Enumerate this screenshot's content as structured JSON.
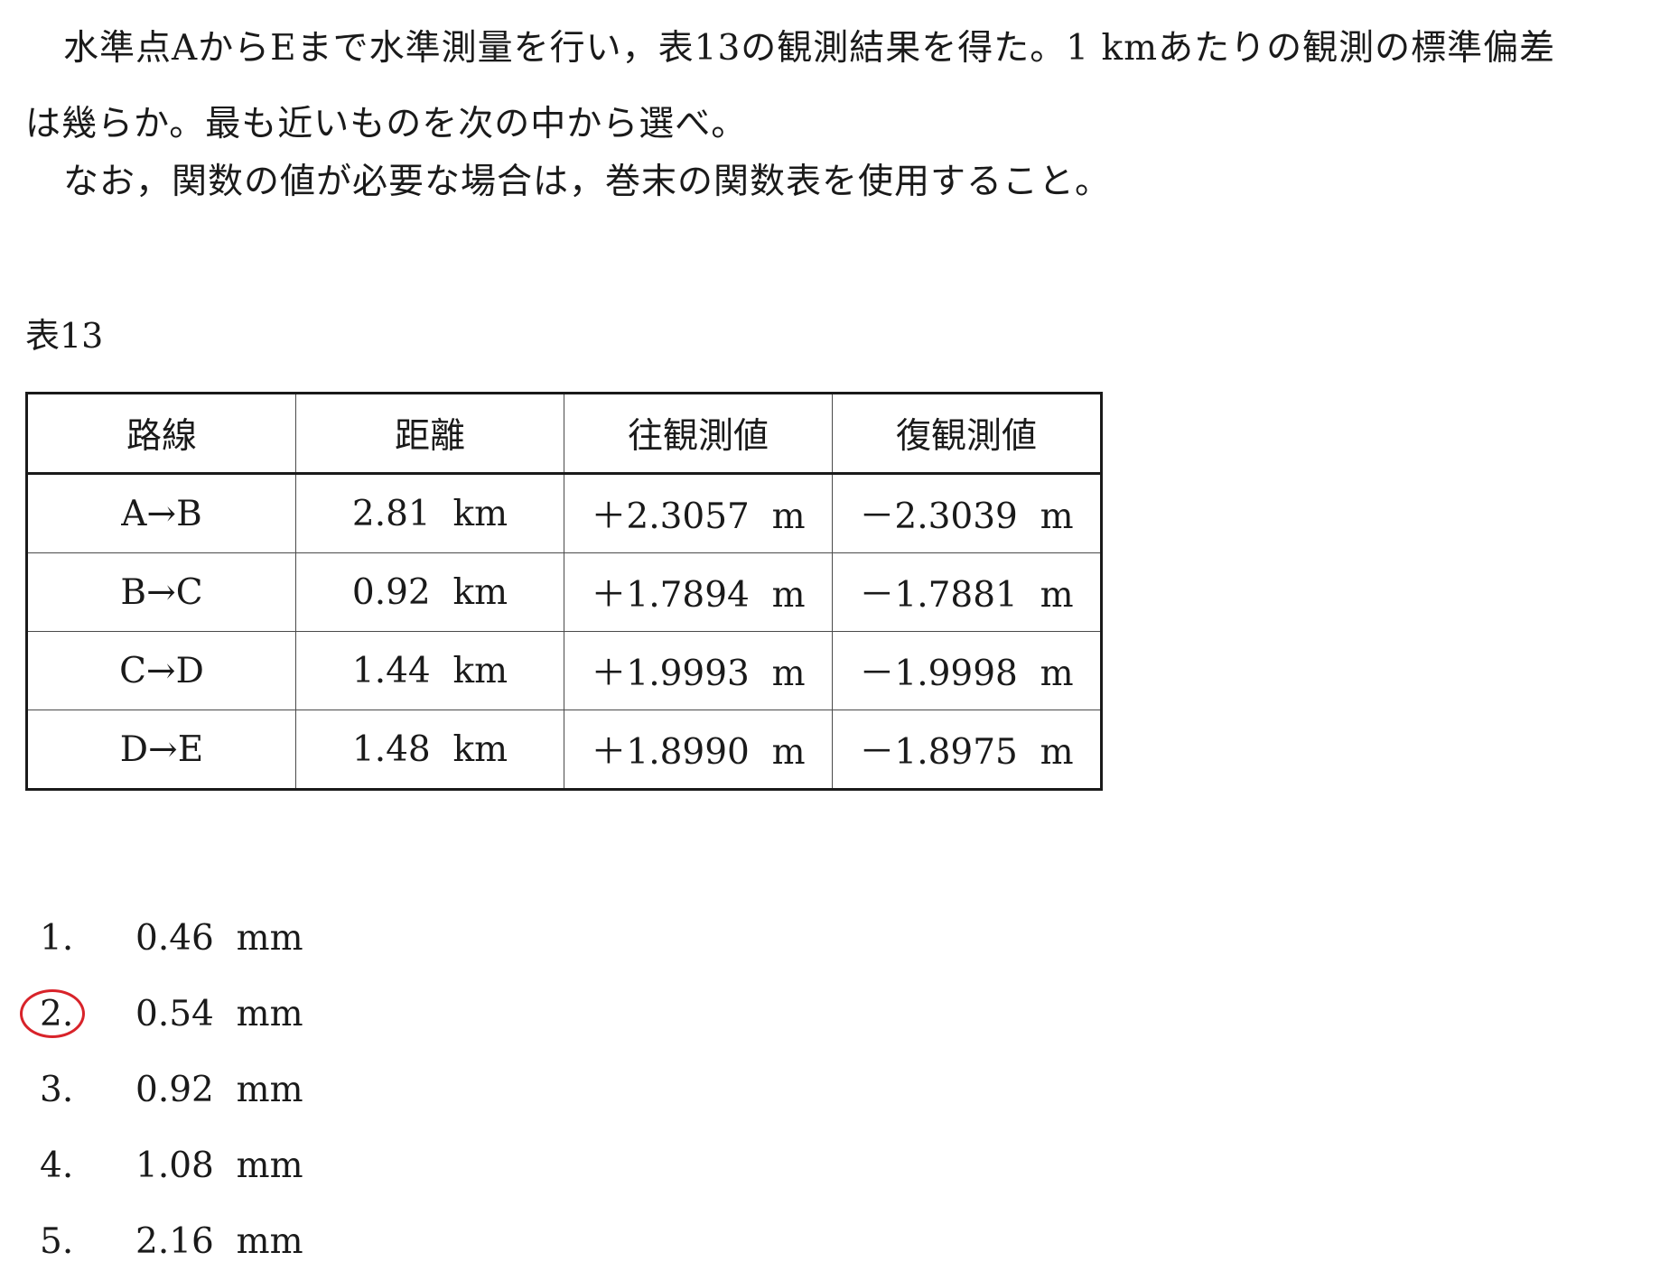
{
  "question": {
    "line1": "水準点AからEまで水準測量を行い，表13の観測結果を得た。1 kmあたりの観測の標準偏差",
    "line2": "は幾らか。最も近いものを次の中から選べ。",
    "line3": "なお，関数の値が必要な場合は，巻末の関数表を使用すること。"
  },
  "table": {
    "caption": "表13",
    "headers": [
      "路線",
      "距離",
      "往観測値",
      "復観測値"
    ],
    "rows": [
      [
        "A→B",
        "2.81  km",
        "＋2.3057  m",
        "－2.3039  m"
      ],
      [
        "B→C",
        "0.92  km",
        "＋1.7894  m",
        "－1.7881  m"
      ],
      [
        "C→D",
        "1.44  km",
        "＋1.9993  m",
        "－1.9998  m"
      ],
      [
        "D→E",
        "1.48  km",
        "＋1.8990  m",
        "－1.8975  m"
      ]
    ]
  },
  "choices": [
    {
      "number": "1.",
      "value": "0.46  mm",
      "circled": false
    },
    {
      "number": "2.",
      "value": "0.54  mm",
      "circled": true
    },
    {
      "number": "3.",
      "value": "0.92  mm",
      "circled": false
    },
    {
      "number": "4.",
      "value": "1.08  mm",
      "circled": false
    },
    {
      "number": "5.",
      "value": "2.16  mm",
      "circled": false
    }
  ],
  "colors": {
    "answer_circle": "#d8232a"
  }
}
